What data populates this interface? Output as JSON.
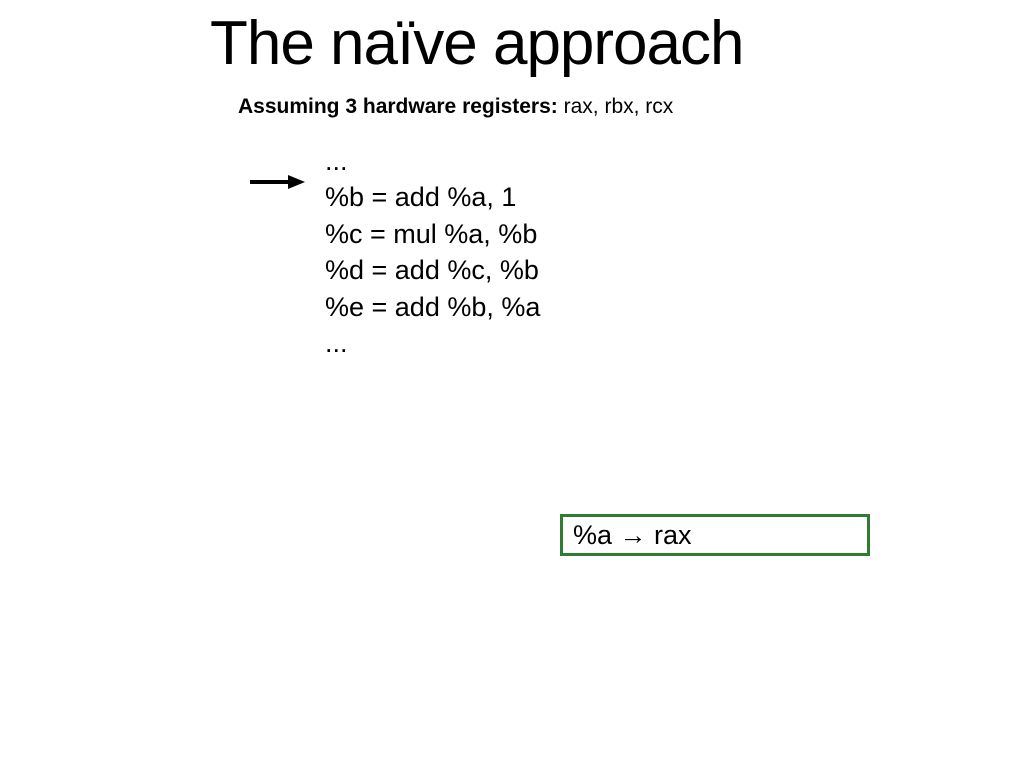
{
  "title": "The naïve approach",
  "subtitle": {
    "bold": "Assuming 3 hardware registers:",
    "regs": " rax, rbx, rcx"
  },
  "code": {
    "l0": "...",
    "l1": "%b = add %a, 1",
    "l2": "%c = mul %a, %b",
    "l3": "%d = add %c, %b",
    "l4": "%e = add %b, %a",
    "l5": "..."
  },
  "mapping": "%a → rax"
}
